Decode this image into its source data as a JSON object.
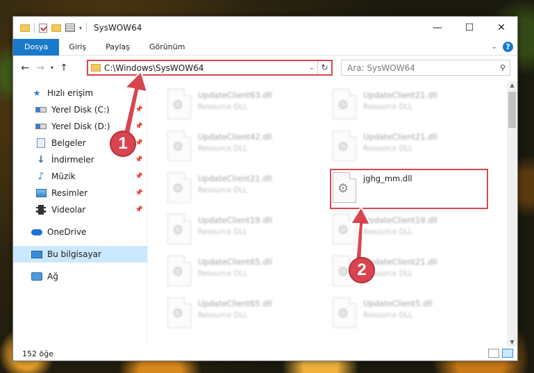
{
  "window": {
    "title": "SysWOW64",
    "minimize": "—",
    "maximize": "☐",
    "close": "✕"
  },
  "ribbon": {
    "tabs": [
      "Dosya",
      "Giriş",
      "Paylaş",
      "Görünüm"
    ],
    "help": "?"
  },
  "address": {
    "path": "C:\\Windows\\SysWOW64",
    "search_placeholder": "Ara: SysWOW64"
  },
  "nav": {
    "quick_access": "Hızlı erişim",
    "items": [
      "Yerel Disk (C:)",
      "Yerel Disk (D:)",
      "Belgeler",
      "İndirmeler",
      "Müzik",
      "Resimler",
      "Videolar"
    ],
    "onedrive": "OneDrive",
    "this_pc": "Bu bilgisayar",
    "network": "Ağ"
  },
  "files": [
    {
      "name": "UpdateClient63.dll",
      "type": "Resource DLL"
    },
    {
      "name": "UpdateClient21.dll",
      "type": "Resource DLL"
    },
    {
      "name": "UpdateClient42.dll",
      "type": "Resource DLL"
    },
    {
      "name": "UpdateClient21.dll",
      "type": "Resource DLL"
    },
    {
      "name": "UpdateClient21.dll",
      "type": "Resource DLL"
    },
    {
      "name": "jghg_mm.dll",
      "type": ""
    },
    {
      "name": "UpdateClient19.dll",
      "type": "Resource DLL"
    },
    {
      "name": "UpdateClient19.dll",
      "type": "Resource DLL"
    },
    {
      "name": "UpdateClient65.dll",
      "type": "Resource DLL"
    },
    {
      "name": "UpdateClient21.dll",
      "type": "Resource DLL"
    },
    {
      "name": "UpdateClient65.dll",
      "type": "Resource DLL"
    },
    {
      "name": "UpdateClient5.dll",
      "type": "Resource DLL"
    }
  ],
  "status": {
    "count": "152 öğe"
  },
  "annotations": {
    "step1": "1",
    "step2": "2",
    "color": "#d9454f"
  }
}
